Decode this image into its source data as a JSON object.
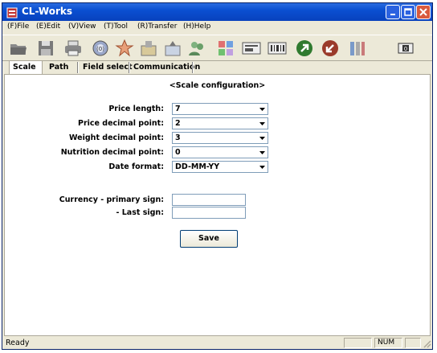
{
  "window": {
    "title": "CL-Works"
  },
  "menu": [
    {
      "label": "(F)File"
    },
    {
      "label": "(E)Edit"
    },
    {
      "label": "(V)View"
    },
    {
      "label": "(T)Tool"
    },
    {
      "label": "(R)Transfer"
    },
    {
      "label": "(H)Help"
    }
  ],
  "toolbar": {
    "icons": [
      "open-folder-icon",
      "save-disk-icon",
      "printer-icon",
      "scale-icon",
      "star-icon",
      "import-icon",
      "export-icon",
      "users-icon",
      "grid-icon",
      "label-icon",
      "barcode-icon",
      "upload-icon",
      "download-icon",
      "tools-icon",
      "badge-icon"
    ],
    "badge_text": "0"
  },
  "tabs": [
    {
      "label": "Scale"
    },
    {
      "label": "Path"
    },
    {
      "label": "Field select"
    },
    {
      "label": "Communication"
    }
  ],
  "form": {
    "heading": "<Scale configuration>",
    "price_length": {
      "label": "Price length:",
      "value": "7"
    },
    "price_decimal": {
      "label": "Price decimal point:",
      "value": "2"
    },
    "weight_decimal": {
      "label": "Weight decimal point:",
      "value": "3"
    },
    "nutrition_decimal": {
      "label": "Nutrition decimal point:",
      "value": "0"
    },
    "date_format": {
      "label": "Date format:",
      "value": "DD-MM-YY"
    },
    "currency_primary": {
      "label": "Currency - primary sign:",
      "value": ""
    },
    "currency_last": {
      "label": "- Last sign:",
      "value": ""
    },
    "save_label": "Save"
  },
  "status": {
    "text": "Ready",
    "num": "NUM"
  },
  "colors": {
    "title_bar": "#0a4fd1",
    "window_bg": "#ece9d8",
    "panel_bg": "#ffffff"
  }
}
